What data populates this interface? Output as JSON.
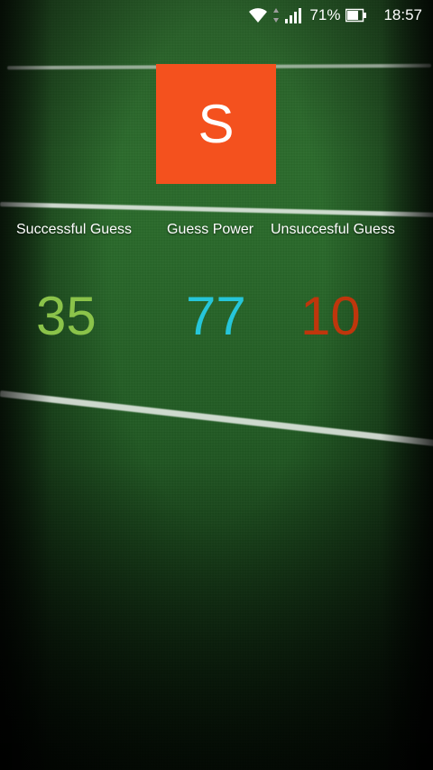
{
  "status_bar": {
    "battery_percent": "71%",
    "time": "18:57",
    "icons": [
      "wifi-icon",
      "signal-icon",
      "battery-icon"
    ]
  },
  "logo": {
    "letter": "S",
    "color": "#f4511e"
  },
  "stats": {
    "successful": {
      "label": "Successful Guess",
      "value": "35",
      "color": "#8bc34a"
    },
    "power": {
      "label": "Guess Power",
      "value": "77",
      "color": "#26c6da"
    },
    "unsuccessful": {
      "label": "Unsuccesful Guess",
      "value": "10",
      "color": "#bf360c"
    }
  }
}
